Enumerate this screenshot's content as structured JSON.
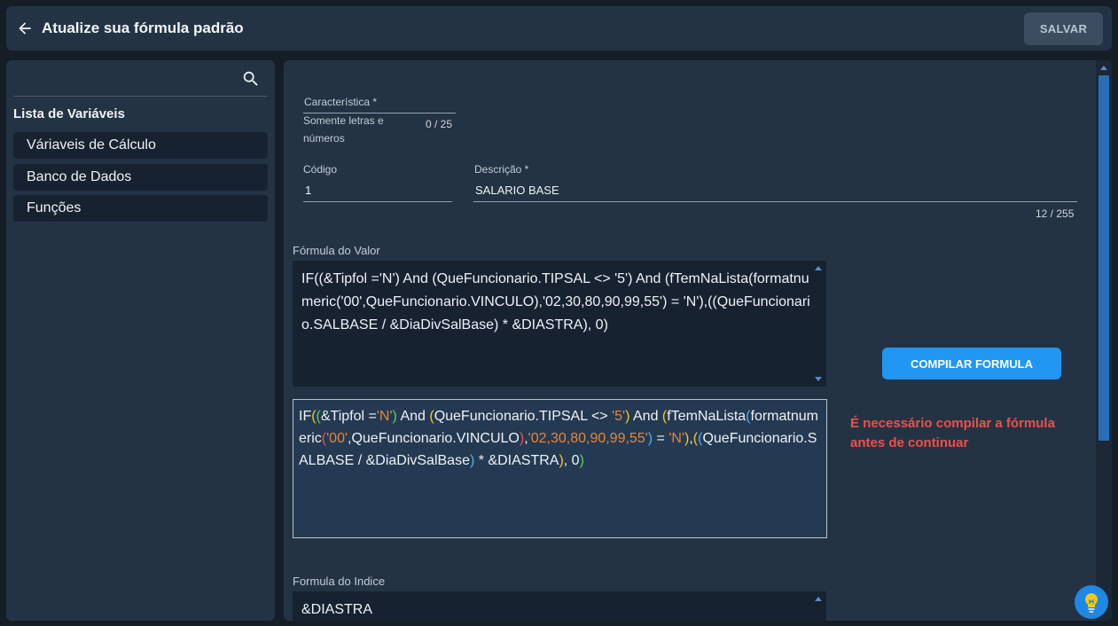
{
  "header": {
    "title": "Atualize sua fórmula padrão",
    "save_label": "SALVAR"
  },
  "sidebar": {
    "search_value": "",
    "list_title": "Lista de Variáveis",
    "items": [
      {
        "label": "Váriaveis de Cálculo"
      },
      {
        "label": "Banco de Dados"
      },
      {
        "label": "Funções"
      }
    ]
  },
  "form": {
    "caracteristica": {
      "label": "Característica *",
      "value": "",
      "hint": "Somente letras e números",
      "counter": "0 / 25"
    },
    "codigo": {
      "label": "Código",
      "value": "1"
    },
    "descricao": {
      "label": "Descrição *",
      "value": "SALARIO BASE",
      "counter": "12 / 255"
    },
    "formula_valor": {
      "label": "Fórmula do Valor",
      "text": "IF((&Tipfol ='N') And (QueFuncionario.TIPSAL <> '5') And (fTemNaLista(formatnumeric('00',QueFuncionario.VINCULO),'02,30,80,90,99,55') = 'N'),((QueFuncionario.SALBASE / &DiaDivSalBase) * &DIASTRA), 0)"
    },
    "highlighted_formula": [
      {
        "t": "IF",
        "c": ""
      },
      {
        "t": "(",
        "c": "c-y"
      },
      {
        "t": "(",
        "c": "c-g"
      },
      {
        "t": "&Tipfol =",
        "c": ""
      },
      {
        "t": "'N'",
        "c": "c-o"
      },
      {
        "t": ")",
        "c": "c-g"
      },
      {
        "t": " And ",
        "c": ""
      },
      {
        "t": "(",
        "c": "c-y"
      },
      {
        "t": "QueFuncionario.TIPSAL <> ",
        "c": ""
      },
      {
        "t": "'5'",
        "c": "c-o"
      },
      {
        "t": ")",
        "c": "c-y"
      },
      {
        "t": " And ",
        "c": ""
      },
      {
        "t": "(",
        "c": "c-y"
      },
      {
        "t": "fTemNaLista",
        "c": ""
      },
      {
        "t": "(",
        "c": "c-b"
      },
      {
        "t": "formatnumeric",
        "c": ""
      },
      {
        "t": "(",
        "c": "c-r"
      },
      {
        "t": "'00'",
        "c": "c-o"
      },
      {
        "t": ",QueFuncionario.VINCULO",
        "c": ""
      },
      {
        "t": ")",
        "c": "c-r"
      },
      {
        "t": ",",
        "c": ""
      },
      {
        "t": "'02,30,80,90,99,55'",
        "c": "c-o"
      },
      {
        "t": ")",
        "c": "c-b"
      },
      {
        "t": " = ",
        "c": ""
      },
      {
        "t": "'N'",
        "c": "c-o"
      },
      {
        "t": ")",
        "c": "c-y"
      },
      {
        "t": ",",
        "c": ""
      },
      {
        "t": "(",
        "c": "c-y"
      },
      {
        "t": "(",
        "c": "c-b"
      },
      {
        "t": "QueFuncionario.SALBASE / &DiaDivSalBase",
        "c": ""
      },
      {
        "t": ")",
        "c": "c-b"
      },
      {
        "t": " * &DIASTRA",
        "c": ""
      },
      {
        "t": ")",
        "c": "c-y"
      },
      {
        "t": ", 0",
        "c": ""
      },
      {
        "t": ")",
        "c": "c-g"
      }
    ],
    "compile_label": "COMPILAR FORMULA",
    "warning": "É necessário compilar a fórmula antes de continuar",
    "formula_indice": {
      "label": "Formula do Indice",
      "text": "&DIASTRA"
    }
  },
  "colors": {
    "accent": "#2196f3",
    "warning": "#f04f47",
    "paren_yellow": "#f5c623",
    "paren_green": "#5fcf5a",
    "paren_blue": "#4fb0f0",
    "paren_red": "#f04f47",
    "string_orange": "#e8853e"
  },
  "icons": {
    "back": "arrow-left-icon",
    "search": "search-icon",
    "help": "lightbulb-icon"
  }
}
